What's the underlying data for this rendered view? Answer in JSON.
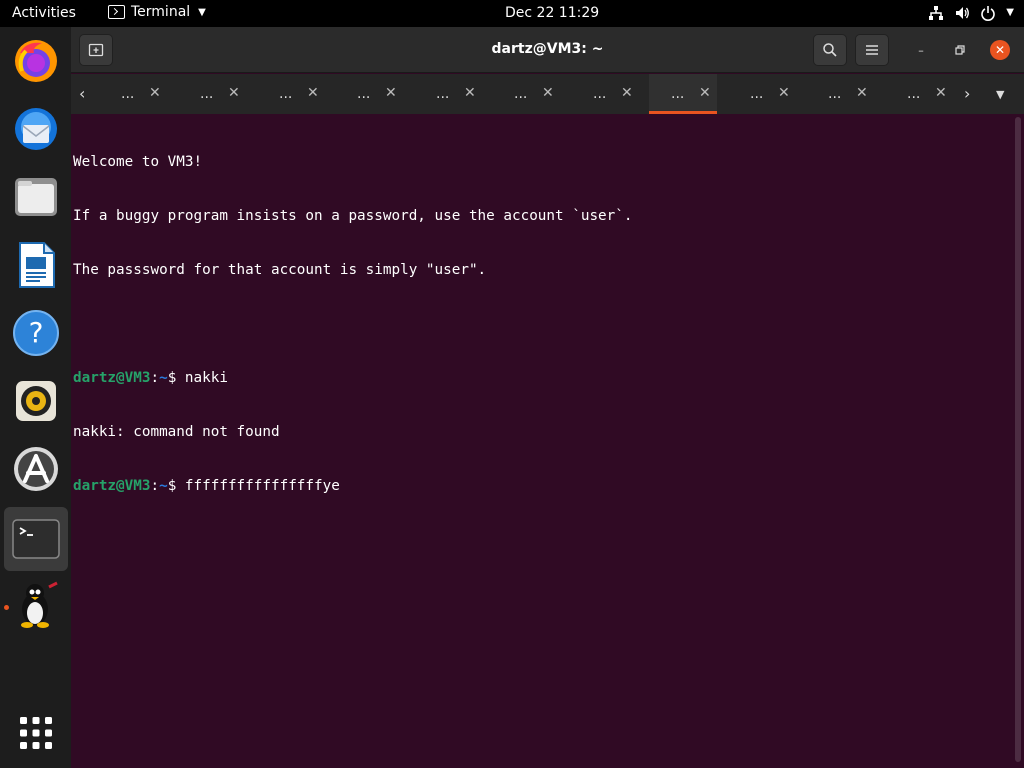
{
  "topbar": {
    "activities": "Activities",
    "app_name": "Terminal",
    "clock": "Dec 22  11:29",
    "tray_icons": [
      "network-icon",
      "volume-icon",
      "power-icon",
      "chevron-down-icon"
    ]
  },
  "dock": {
    "items": [
      {
        "name": "firefox",
        "icon": "firefox-icon"
      },
      {
        "name": "thunderbird",
        "icon": "thunderbird-icon"
      },
      {
        "name": "files",
        "icon": "files-icon"
      },
      {
        "name": "libreoffice-writer",
        "icon": "writer-icon"
      },
      {
        "name": "help",
        "icon": "help-icon"
      },
      {
        "name": "rhythmbox",
        "icon": "rhythmbox-icon"
      },
      {
        "name": "software",
        "icon": "software-icon"
      },
      {
        "name": "terminal",
        "icon": "terminal-icon",
        "active": true,
        "running": true
      },
      {
        "name": "tux-game",
        "icon": "tux-icon",
        "running": true
      }
    ],
    "show_apps_icon": "app-grid-icon"
  },
  "window": {
    "title": "dartz@VM3: ~",
    "tabs": [
      {
        "label": "..."
      },
      {
        "label": "..."
      },
      {
        "label": "..."
      },
      {
        "label": "..."
      },
      {
        "label": "..."
      },
      {
        "label": "..."
      },
      {
        "label": "..."
      },
      {
        "label": "...",
        "active": true
      },
      {
        "label": "..."
      },
      {
        "label": "..."
      },
      {
        "label": "..."
      }
    ]
  },
  "terminal": {
    "lines": [
      {
        "text": "Welcome to VM3!"
      },
      {
        "text": "If a buggy program insists on a password, use the account `user`."
      },
      {
        "text": "The passsword for that account is simply \"user\"."
      },
      {
        "text": ""
      },
      {
        "prompt_user": "dartz@VM3",
        "prompt_sep": ":",
        "prompt_path": "~",
        "prompt_sym": "$ ",
        "text": "nakki"
      },
      {
        "text": "nakki: command not found"
      },
      {
        "prompt_user": "dartz@VM3",
        "prompt_sep": ":",
        "prompt_path": "~",
        "prompt_sym": "$ ",
        "text": "ffffffffffffffffye"
      }
    ]
  },
  "colors": {
    "terminal_bg": "#300a24",
    "accent": "#e95420",
    "prompt_user": "#26a269",
    "prompt_path": "#2a7bde"
  }
}
